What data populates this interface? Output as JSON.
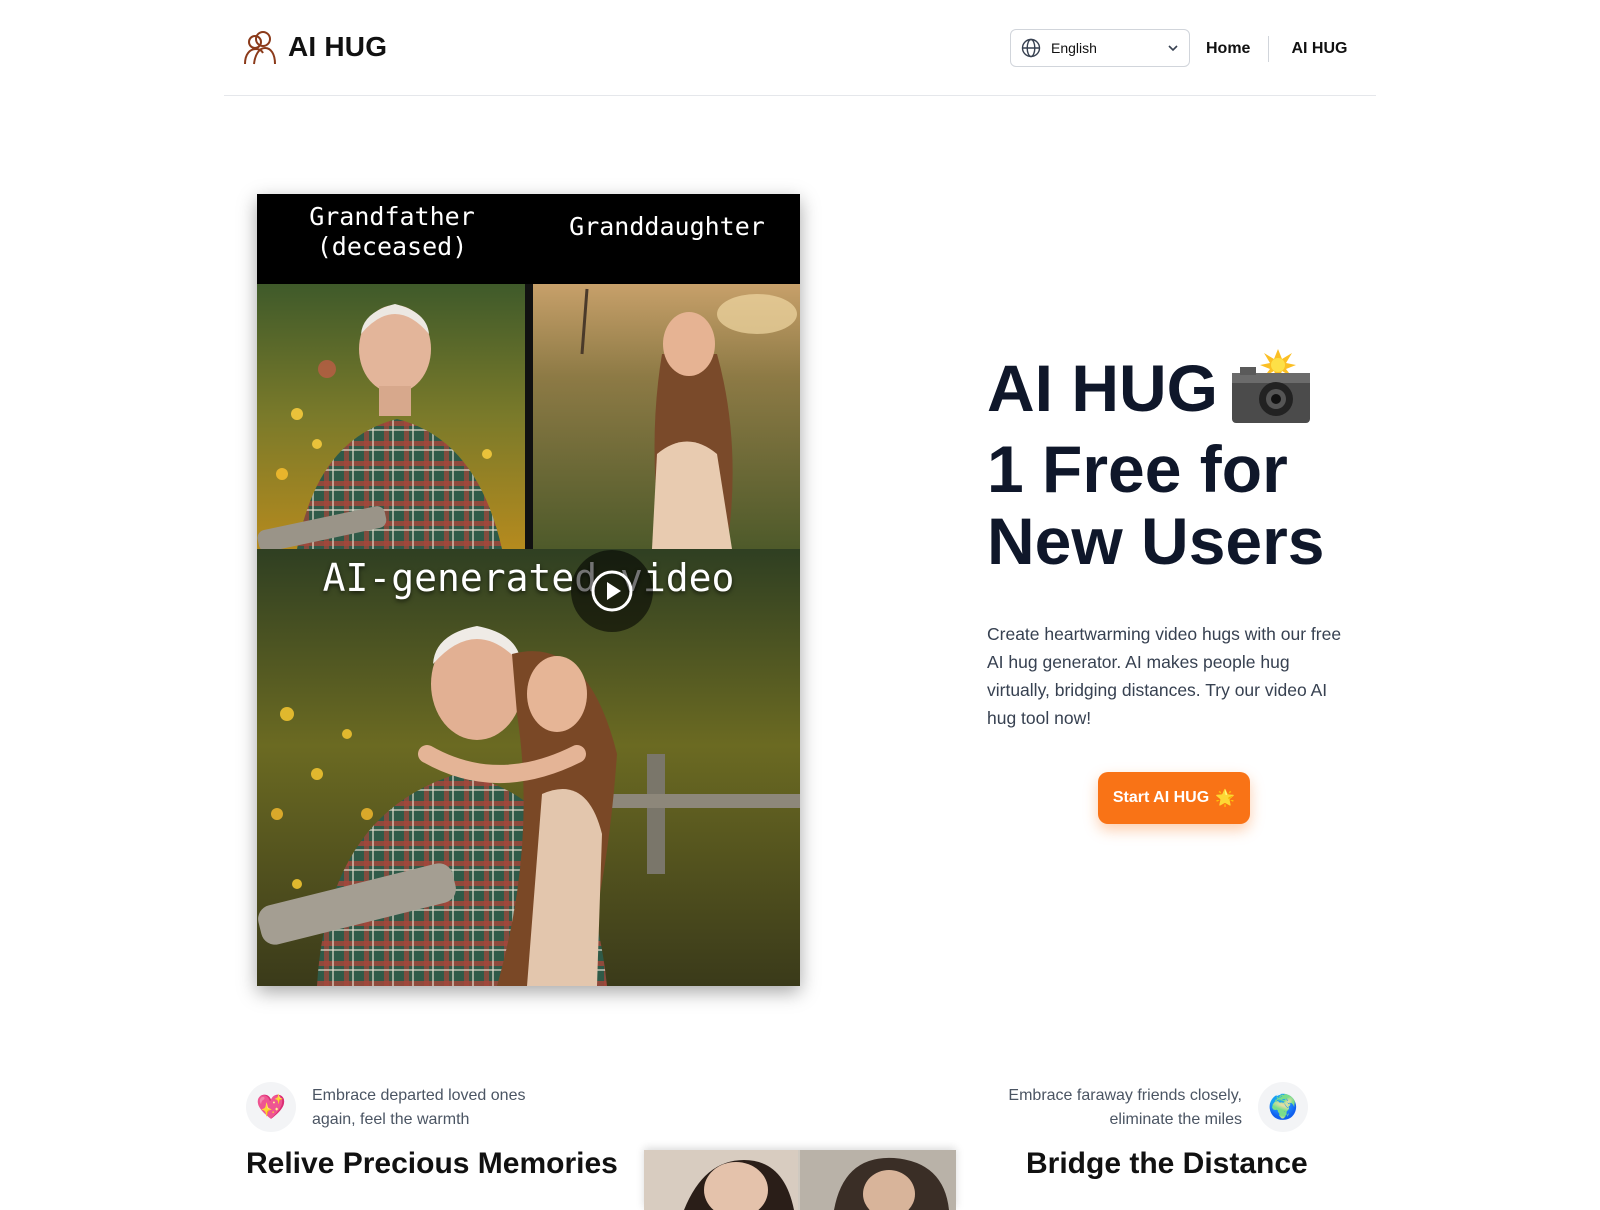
{
  "header": {
    "brand_name": "AI HUG",
    "language": {
      "selected": "English"
    },
    "nav": [
      {
        "label": "Home"
      },
      {
        "label": "AI HUG"
      }
    ]
  },
  "hero": {
    "media": {
      "label_left": "Grandfather\n(deceased)",
      "label_right": "Granddaughter",
      "label_bottom": "AI-generated video"
    },
    "title_line1": "AI HUG",
    "title_line2": "1 Free for",
    "title_line3": "New Users",
    "description": "Create heartwarming video hugs with our free AI hug generator. AI makes people hug virtually, bridging distances. Try our video AI hug tool now!",
    "cta_label": "Start AI HUG",
    "cta_emoji": "🌟"
  },
  "features": [
    {
      "icon": "sparkling-heart-icon",
      "emoji": "💖",
      "text": "Embrace departed loved ones again, feel the warmth",
      "title": "Relive Precious Memories"
    },
    {
      "icon": "globe-icon",
      "emoji": "🌍",
      "text": "Embrace faraway friends closely, eliminate the miles",
      "title": "Bridge the Distance"
    }
  ],
  "colors": {
    "accent": "#f97316",
    "title": "#0f172a",
    "body_text": "#374151"
  }
}
